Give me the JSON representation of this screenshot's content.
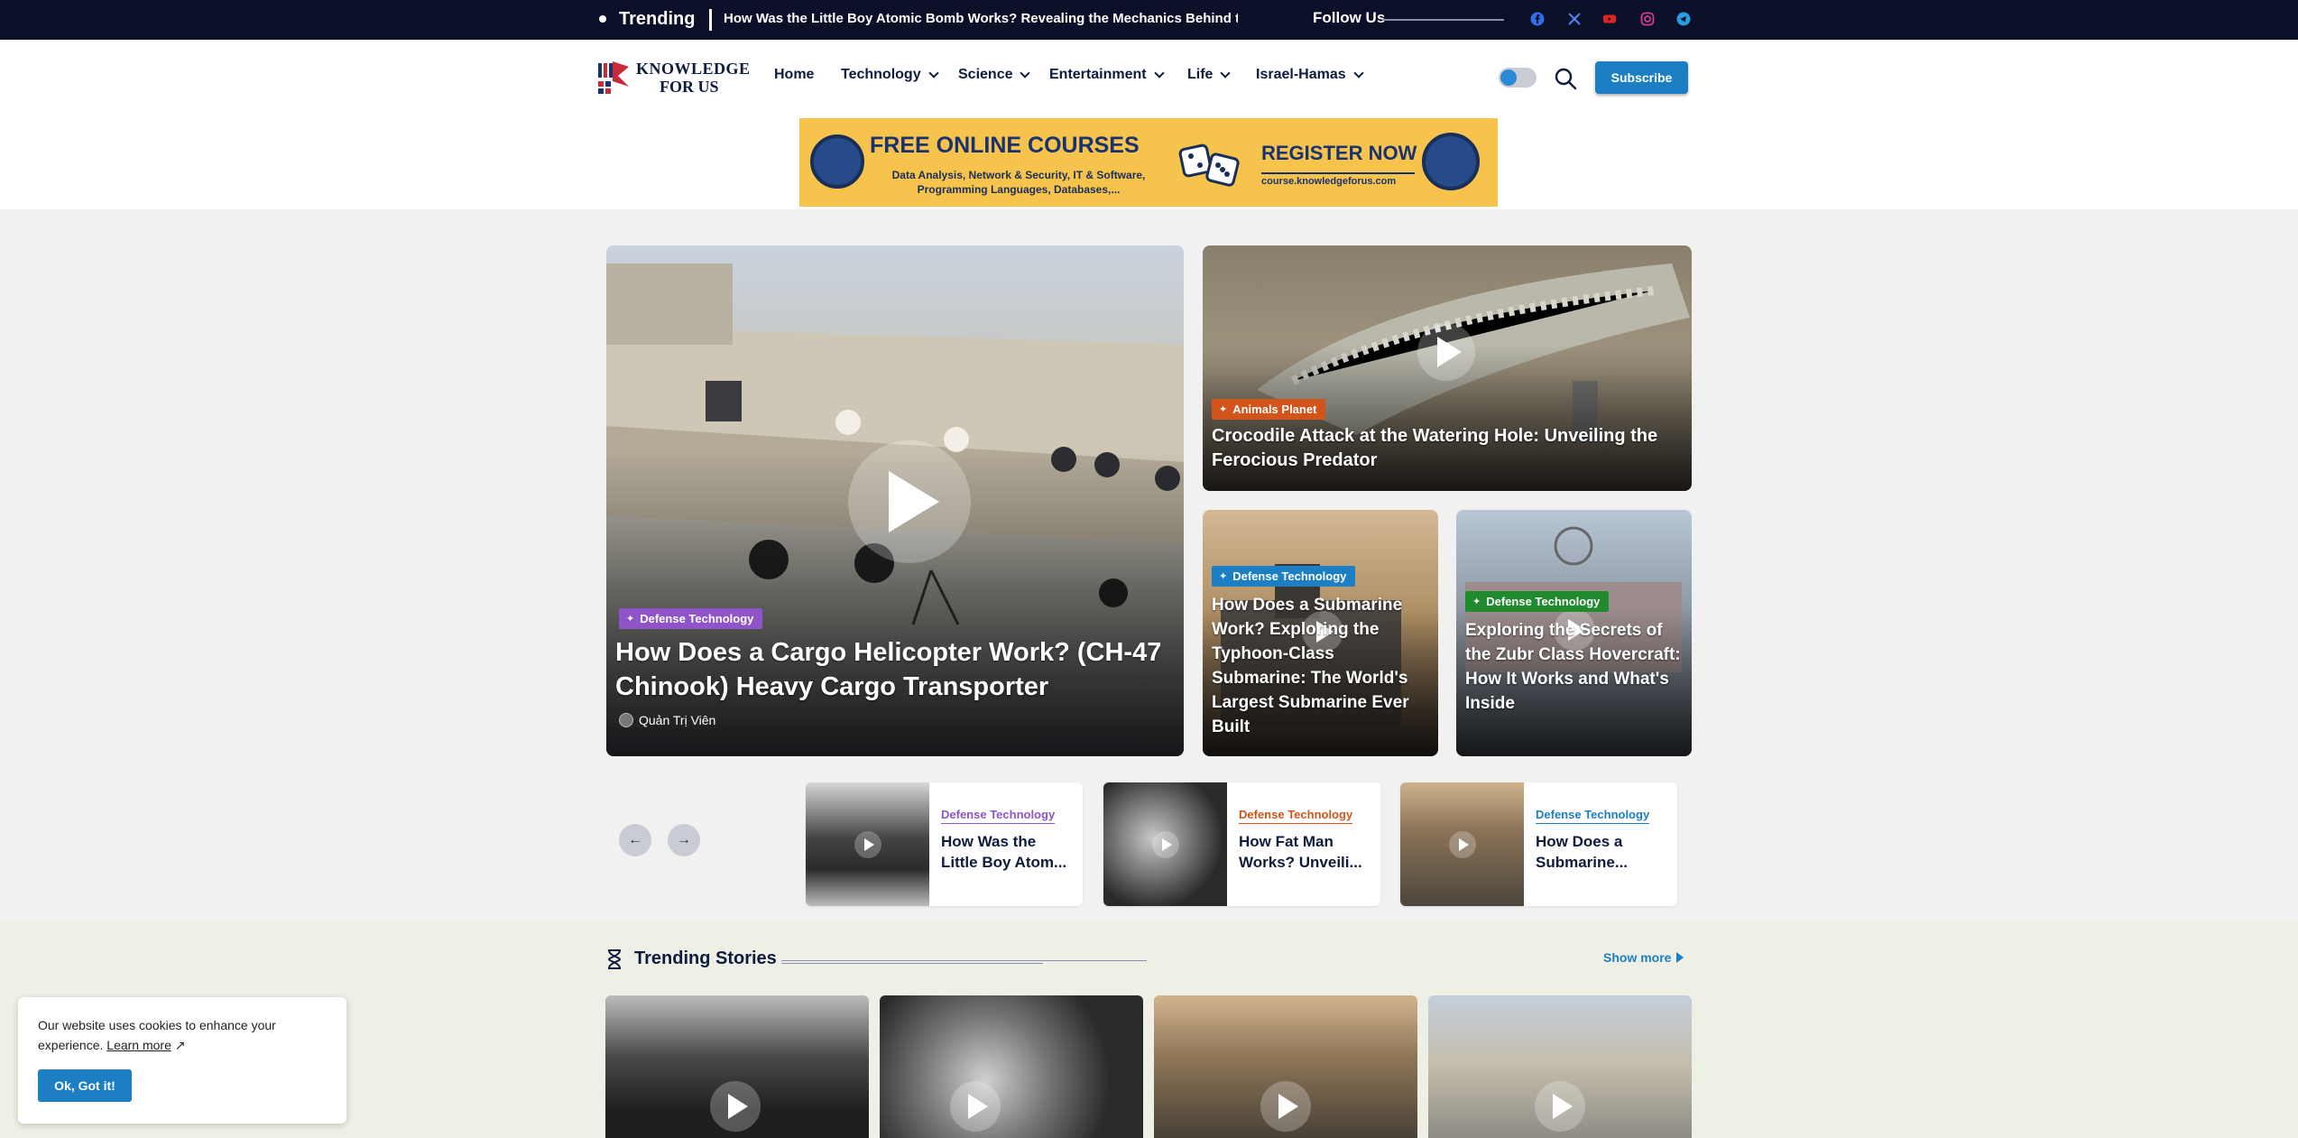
{
  "topbar": {
    "trending_label": "Trending",
    "headline": "How Was the Little Boy Atomic Bomb Works? Revealing the Mechanics Behind the",
    "follow_label": "Follow Us",
    "social_icons": [
      "facebook-icon",
      "x-icon",
      "youtube-icon",
      "instagram-icon",
      "telegram-icon"
    ]
  },
  "header": {
    "logo_line1": "KNOWLEDGE",
    "logo_line2": "FOR US",
    "nav": [
      {
        "label": "Home",
        "dropdown": false
      },
      {
        "label": "Technology",
        "dropdown": true
      },
      {
        "label": "Science",
        "dropdown": true
      },
      {
        "label": "Entertainment",
        "dropdown": true
      },
      {
        "label": "Life",
        "dropdown": true
      },
      {
        "label": "Israel-Hamas",
        "dropdown": true
      }
    ],
    "subscribe_label": "Subscribe"
  },
  "banner": {
    "title": "FREE ONLINE COURSES",
    "subtitle": "Data Analysis, Network & Security, IT & Software, Programming Languages, Databases,...",
    "cta": "REGISTER NOW",
    "url": "course.knowledgeforus.com"
  },
  "featured": {
    "main": {
      "category": "Defense Technology",
      "category_color": "#8e54c8",
      "title": "How Does a Cargo Helicopter Work? (CH-47 Chinook) Heavy Cargo Transporter",
      "author": "Quản Trị Viên"
    },
    "top_right": {
      "category": "Animals Planet",
      "category_color": "#d2541b",
      "title": "Crocodile Attack at the Watering Hole: Unveiling the Ferocious Predator"
    },
    "bottom_left": {
      "category": "Defense Technology",
      "category_color": "#1c7fc4",
      "title": "How Does a Submarine Work? Exploring the Typhoon-Class Submarine: The World's Largest Submarine Ever Built"
    },
    "bottom_right": {
      "category": "Defense Technology",
      "category_color": "#1f8a2e",
      "title": "Exploring the Secrets of the Zubr Class Hovercraft: How It Works and What's Inside"
    }
  },
  "carousel": {
    "items": [
      {
        "category": "Defense Technology",
        "category_color": "#8e54c8",
        "title": "How Was the Little Boy Atom..."
      },
      {
        "category": "Defense Technology",
        "category_color": "#d2541b",
        "title": "How Fat Man Works? Unveili..."
      },
      {
        "category": "Defense Technology",
        "category_color": "#1c7fc4",
        "title": "How Does a Submarine..."
      }
    ]
  },
  "trending": {
    "title": "Trending Stories",
    "show_more": "Show more"
  },
  "cookie": {
    "text": "Our website uses cookies to enhance your experience.",
    "link": "Learn more",
    "button": "Ok, Got it!"
  },
  "colors": {
    "topbar": "#0b1029",
    "accent": "#1c7fc4",
    "navy": "#0d1b3f"
  }
}
